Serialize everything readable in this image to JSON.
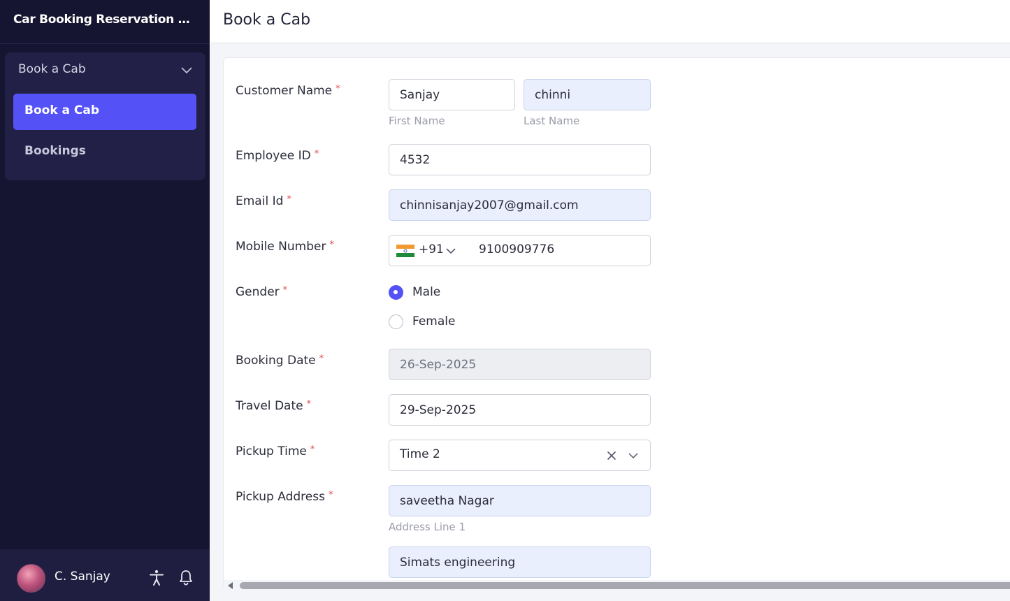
{
  "app": {
    "title": "Car Booking Reservation System"
  },
  "sidebar": {
    "group_label": "Book a Cab",
    "items": [
      {
        "label": "Book a Cab",
        "active": true
      },
      {
        "label": "Bookings",
        "active": false
      }
    ],
    "user": {
      "name": "C. Sanjay"
    }
  },
  "header": {
    "title": "Book a Cab"
  },
  "form": {
    "customer_name": {
      "label": "Customer Name",
      "required": "*",
      "first": "Sanjay",
      "last": "chinni",
      "first_hint": "First Name",
      "last_hint": "Last Name"
    },
    "employee_id": {
      "label": "Employee ID",
      "required": "*",
      "value": "4532"
    },
    "email": {
      "label": "Email Id",
      "required": "*",
      "value": "chinnisanjay2007@gmail.com"
    },
    "mobile": {
      "label": "Mobile Number",
      "required": "*",
      "country_code": "+91",
      "value": "9100909776"
    },
    "gender": {
      "label": "Gender",
      "required": "*",
      "options": [
        "Male",
        "Female"
      ],
      "selected": "Male"
    },
    "booking_date": {
      "label": "Booking Date",
      "required": "*",
      "value": "26-Sep-2025"
    },
    "travel_date": {
      "label": "Travel Date",
      "required": "*",
      "value": "29-Sep-2025"
    },
    "pickup_time": {
      "label": "Pickup Time",
      "required": "*",
      "value": "Time 2"
    },
    "pickup_address": {
      "label": "Pickup Address",
      "required": "*",
      "line1": "saveetha Nagar",
      "line1_hint": "Address Line 1",
      "line2": "Simats engineering"
    }
  },
  "icons": {
    "chevron": "chevron-down-icon",
    "accessibility": "accessibility-icon",
    "notifications": "bell-icon",
    "clear": "close-icon",
    "flag": "india-flag-icon"
  },
  "colors": {
    "sidebar_bg": "#161531",
    "nav_group_bg": "#222046",
    "accent": "#5452f6",
    "required": "#e5484d",
    "filled_input_bg": "#e9effd"
  }
}
